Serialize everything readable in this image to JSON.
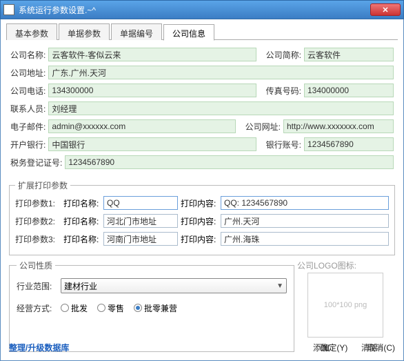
{
  "title": "系统运行参数设置.~^",
  "tabs": [
    "基本参数",
    "单据参数",
    "单据编号",
    "公司信息"
  ],
  "activeTab": 3,
  "labels": {
    "companyName": "公司名称:",
    "companyShort": "公司简称:",
    "address": "公司地址:",
    "phone": "公司电话:",
    "fax": "传真号码:",
    "contact": "联系人员:",
    "email": "电子邮件:",
    "website": "公司网址:",
    "bank": "开户银行:",
    "account": "银行账号:",
    "taxReg": "税务登记证号:"
  },
  "values": {
    "companyName": "云客软件-客似云来",
    "companyShort": "云客软件",
    "address": "广东.广州.天河",
    "phone": "134300000",
    "fax": "134000000",
    "contact": "刘经理",
    "email": "admin@xxxxxx.com",
    "website": "http://www.xxxxxxx.com",
    "bank": "中国银行",
    "account": "1234567890",
    "taxReg": "1234567890"
  },
  "ext": {
    "legend": "扩展打印参数",
    "rowLabel": [
      "打印参数1:",
      "打印参数2:",
      "打印参数3:"
    ],
    "nameLabel": "打印名称:",
    "contentLabel": "打印内容:",
    "names": [
      "QQ",
      "河北门市地址",
      "河南门市地址"
    ],
    "contents": [
      "QQ: 1234567890",
      "广州.天河",
      "广州.海珠"
    ]
  },
  "nature": {
    "legend": "公司性质",
    "industryLabel": "行业范围:",
    "industryValue": "建材行业",
    "modeLabel": "经营方式:",
    "modes": [
      "批发",
      "零售",
      "批零兼营"
    ],
    "selectedMode": 2
  },
  "logo": {
    "label": "公司LOGO图标:",
    "placeholder": "100*100 png",
    "add": "添加",
    "clear": "清除"
  },
  "footer": {
    "link": "整理/升级数据库",
    "ok": "确定(Y)",
    "cancel": "取消(C)"
  }
}
